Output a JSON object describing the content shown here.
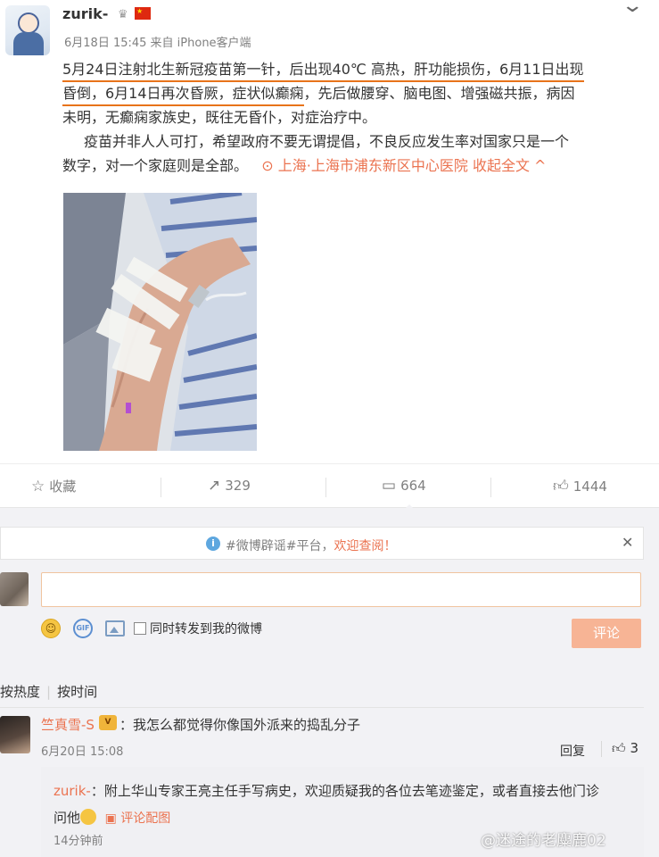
{
  "post": {
    "username": "zurik-",
    "meta": "6月18日 15:45 来自 iPhone客户端",
    "text_line1_a": "5月24日注射北生新冠疫苗第一针，后出现40℃ 高热，肝功能损伤，6月11日出现",
    "text_line2_a": "昏倒，6月14日再次昏厥，症状似癫痫",
    "text_line2_b": "，先后做腰穿、脑电图、增强磁共振，病因",
    "text_line3": "未明，无癫痫家族史，既往无昏仆，对症治疗中。",
    "text_line4": "疫苗并非人人可打，希望政府不要无谓提倡，不良反应发生率对国家只是一个",
    "text_line5_a": "数字，对一个家庭则是全部。",
    "location": "上海·上海市浦东新区中心医院",
    "collapse": "收起全文 ^"
  },
  "actions": {
    "favorite": "收藏",
    "repost": "329",
    "comment": "664",
    "like": "1444"
  },
  "notice": {
    "prefix": "#微博辟谣#平台，",
    "highlight": "欢迎查阅！"
  },
  "composer": {
    "placeholder": "",
    "sync_label": "同时转发到我的微博",
    "submit": "评论"
  },
  "sort": {
    "hot": "按热度",
    "time": "按时间"
  },
  "comment": {
    "name": "竺真雪-S",
    "text": "：我怎么都觉得你像国外派来的捣乱分子",
    "time": "6月20日 15:08",
    "reply": "回复",
    "likes": "3"
  },
  "reply": {
    "name": "zurik-",
    "text": "：附上华山专家王亮主任手写病史，欢迎质疑我的各位去笔迹鉴定，或者直接去他门诊",
    "text2": "问他",
    "pic_link": "评论配图",
    "time": "14分钟前"
  },
  "watermark": "@迷途的老麋鹿02"
}
